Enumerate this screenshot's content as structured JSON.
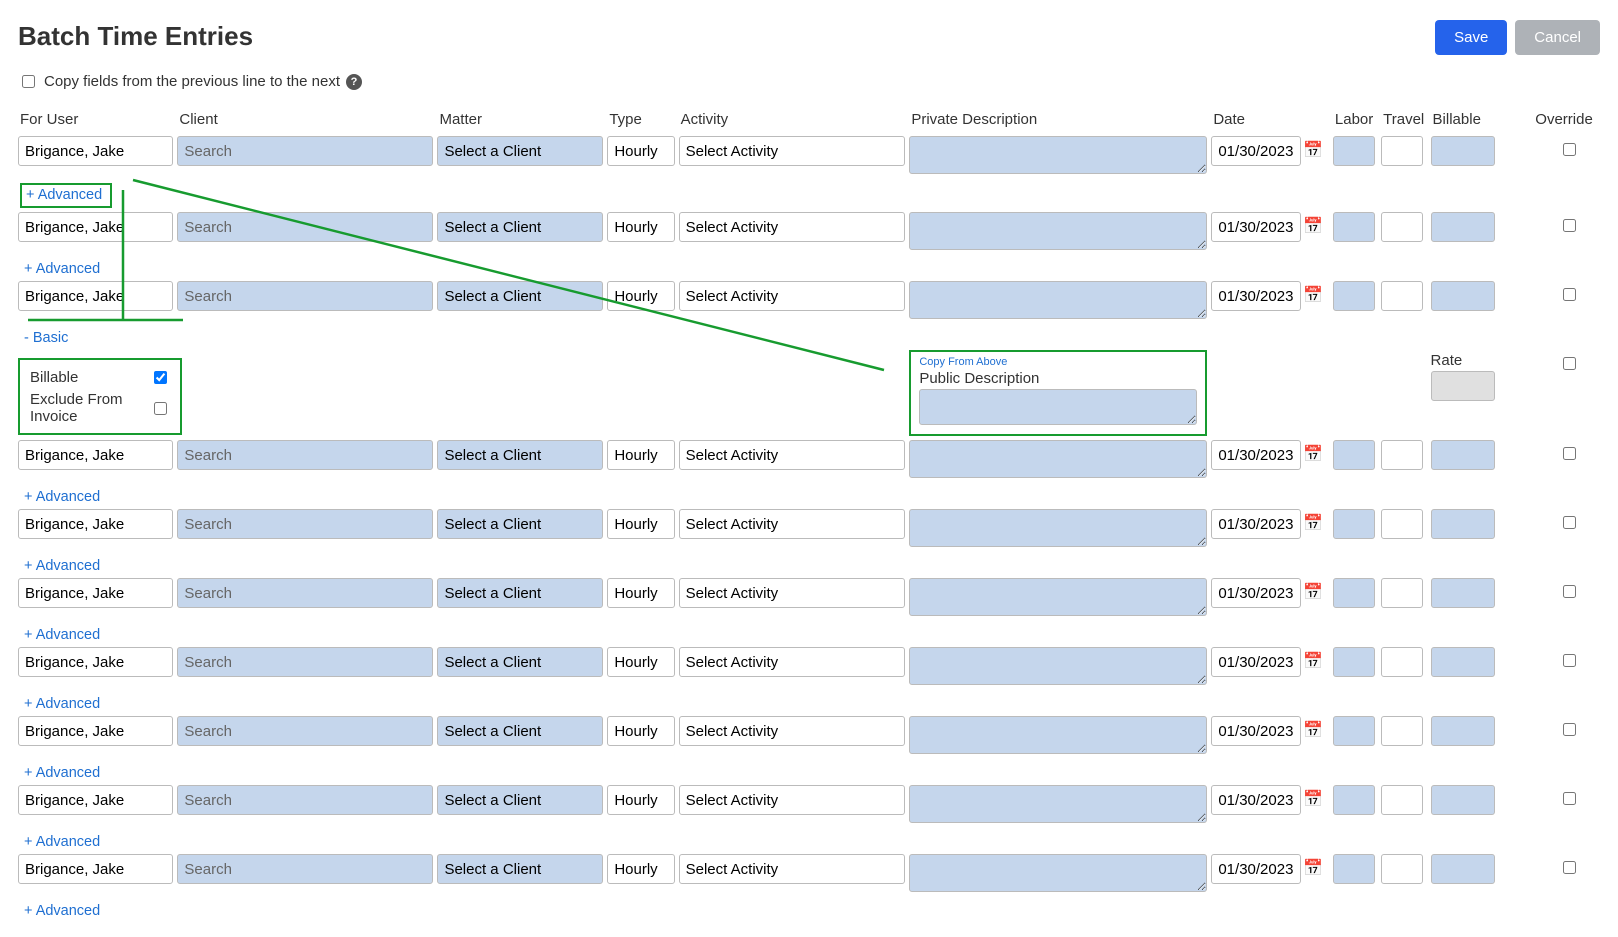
{
  "page": {
    "title": "Batch Time Entries",
    "save": "Save",
    "cancel": "Cancel",
    "copy_fields_label": "Copy fields from the previous line to the next"
  },
  "headers": {
    "user": "For User",
    "client": "Client",
    "matter": "Matter",
    "type": "Type",
    "activity": "Activity",
    "private_description": "Private Description",
    "date": "Date",
    "labor": "Labor",
    "travel": "Travel",
    "billable": "Billable",
    "override": "Override"
  },
  "defaults": {
    "user_value": "Brigance, Jake",
    "client_placeholder": "Search",
    "matter_placeholder": "Select a Client",
    "type_value": "Hourly",
    "activity_placeholder": "Select Activity",
    "date_value": "01/30/2023",
    "advanced_link": "+ Advanced",
    "basic_link": "- Basic"
  },
  "advanced_panel": {
    "billable_label": "Billable",
    "billable_checked": true,
    "exclude_label": "Exclude From Invoice",
    "exclude_checked": false
  },
  "public_panel": {
    "copy_link": "Copy From Above",
    "label": "Public Description"
  },
  "rate_label": "Rate"
}
